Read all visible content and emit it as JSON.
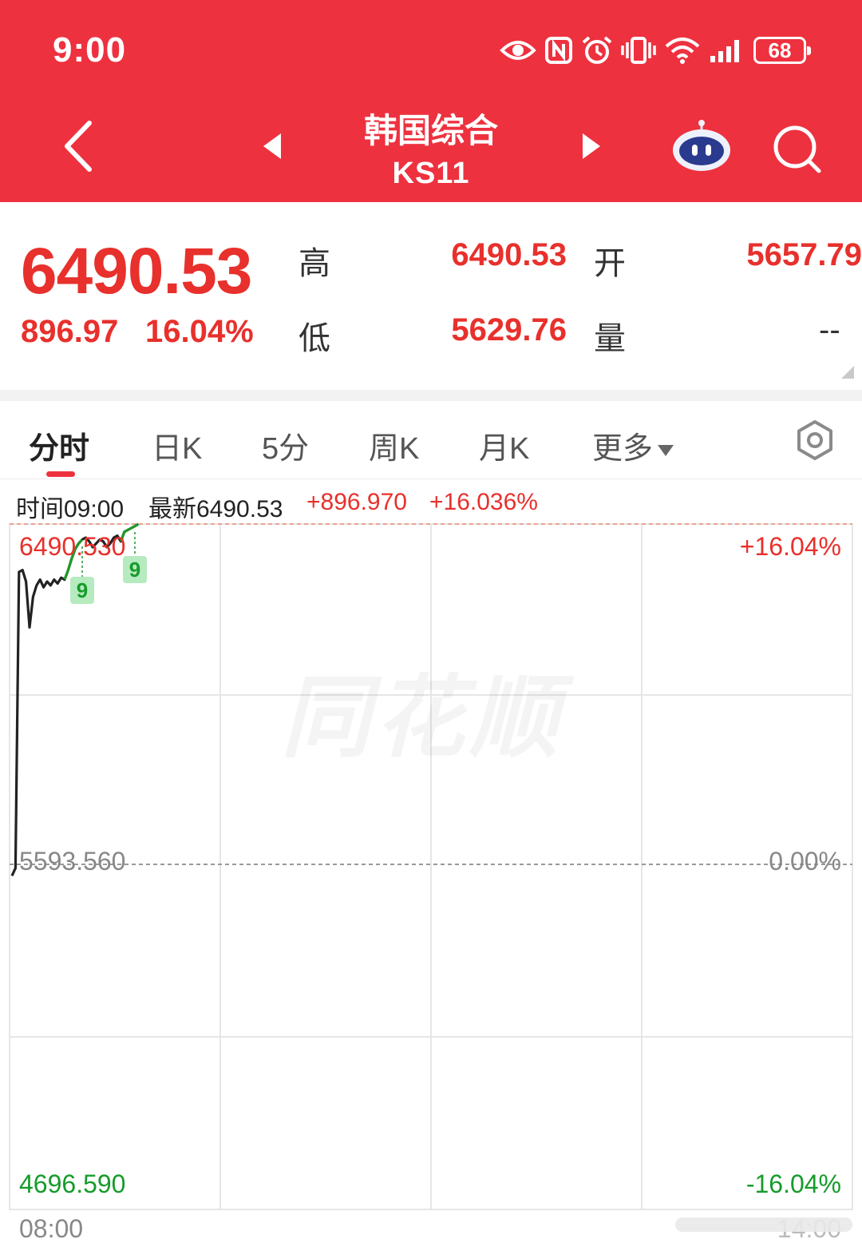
{
  "status_bar": {
    "time": "9:00",
    "battery": "68",
    "icons": [
      "eye-icon",
      "nfc-icon",
      "alarm-icon",
      "vibrate-icon",
      "wifi-icon",
      "signal-icon",
      "battery-icon"
    ]
  },
  "header": {
    "title": "韩国综合",
    "code": "KS11",
    "icons": [
      "back-arrow-icon",
      "prev-triangle-icon",
      "next-triangle-icon",
      "robot-assistant-icon",
      "search-icon"
    ]
  },
  "quote": {
    "price": "6490.53",
    "change": "896.97",
    "change_pct": "16.04%",
    "high_label": "高",
    "high": "6490.53",
    "open_label": "开",
    "open": "5657.79",
    "low_label": "低",
    "low": "5629.76",
    "volume_label": "量",
    "volume": "--"
  },
  "tabs": {
    "items": [
      "分时",
      "日K",
      "5分",
      "周K",
      "月K",
      "更多"
    ],
    "active": "分时"
  },
  "info_row": {
    "time_label": "时间09:00",
    "latest_label": "最新6490.53",
    "change": "+896.970",
    "change_pct": "+16.036%"
  },
  "chart": {
    "watermark": "同花顺",
    "y_top": "6490.530",
    "y_mid": "5593.560",
    "y_bottom": "4696.590",
    "pct_top": "+16.04%",
    "pct_mid": "0.00%",
    "pct_bottom": "-16.04%",
    "x_start": "08:00",
    "x_end": "14:00",
    "tags": [
      "9",
      "9"
    ]
  },
  "colors": {
    "header_red": "#ee313f",
    "up_red": "#e8302c",
    "down_green": "#169b2b",
    "price_line": "#222222",
    "signal_line": "#1f9a2a"
  },
  "chart_data": {
    "type": "line",
    "xlabel": "",
    "ylabel": "",
    "x_range": [
      "08:00",
      "14:00"
    ],
    "ylim": [
      4696.59,
      6490.53
    ],
    "baseline": 5593.56,
    "series": [
      {
        "x": [
          0,
          1,
          2,
          3,
          4,
          5,
          6,
          7,
          8,
          9,
          10,
          11,
          12,
          13,
          14,
          15,
          16,
          17,
          18,
          19,
          20,
          21,
          22,
          23,
          24,
          25,
          26,
          27,
          28,
          29,
          30,
          31,
          32,
          33,
          34,
          35,
          36
        ],
        "values": [
          5570,
          5590,
          6365,
          6370,
          6340,
          6220,
          6300,
          6330,
          6345,
          6325,
          6340,
          6330,
          6345,
          6335,
          6350,
          6345,
          6370,
          6400,
          6425,
          6440,
          6450,
          6455,
          6445,
          6430,
          6440,
          6450,
          6445,
          6430,
          6440,
          6455,
          6460,
          6445,
          6470,
          6475,
          6480,
          6485,
          6490.53
        ]
      }
    ]
  }
}
